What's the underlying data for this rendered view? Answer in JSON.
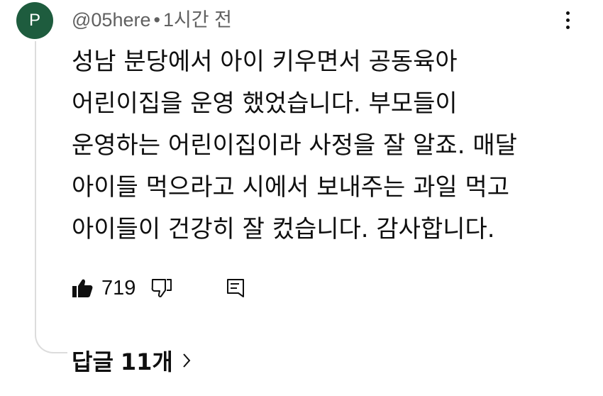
{
  "comment": {
    "avatar_letter": "P",
    "avatar_color": "#1e5c3e",
    "author": "@05here",
    "separator": "•",
    "time": "1시간 전",
    "lines": [
      "성남 분당에서 아이 키우면서 공동육아",
      "어린이집을 운영 했었습니다. 부모들이",
      "운영하는 어린이집이라 사정을 잘 알죠. 매달",
      "아이들 먹으라고 시에서 보내주는 과일 먹고",
      "아이들이 건강히 잘 컸습니다. 감사합니다."
    ],
    "like_count": "719",
    "replies_label": "답글",
    "replies_count": "11개"
  },
  "icons": {
    "more": "more-vert-icon",
    "like": "thumb-up-icon",
    "dislike": "thumb-down-icon",
    "reply": "comment-reply-icon",
    "chevron": "chevron-right-icon"
  }
}
